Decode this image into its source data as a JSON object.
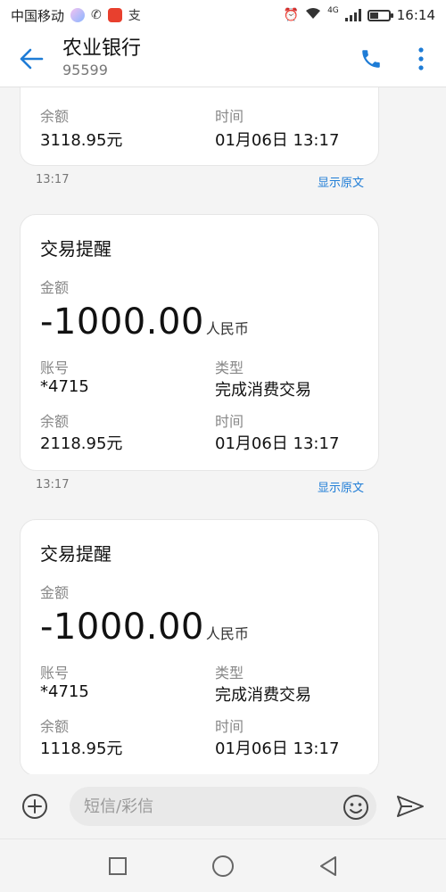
{
  "status_bar": {
    "carrier": "中国移动",
    "net_label": "4G",
    "time": "16:14",
    "battery_level": 0.45
  },
  "header": {
    "title": "农业银行",
    "subtitle": "95599"
  },
  "messages": [
    {
      "partial": true,
      "balance_label": "余额",
      "balance": "3118.95元",
      "time_label": "时间",
      "time": "01月06日 13:17",
      "timestamp": "13:17",
      "show_original": "显示原文"
    },
    {
      "title": "交易提醒",
      "amount_label": "金额",
      "amount": "-1000.00",
      "currency": "人民币",
      "account_label": "账号",
      "account": "*4715",
      "type_label": "类型",
      "type": "完成消费交易",
      "balance_label": "余额",
      "balance": "2118.95元",
      "time_label": "时间",
      "time": "01月06日 13:17",
      "timestamp": "13:17",
      "show_original": "显示原文"
    },
    {
      "title": "交易提醒",
      "amount_label": "金额",
      "amount": "-1000.00",
      "currency": "人民币",
      "account_label": "账号",
      "account": "*4715",
      "type_label": "类型",
      "type": "完成消费交易",
      "balance_label": "余额",
      "balance": "1118.95元",
      "time_label": "时间",
      "time": "01月06日 13:17"
    }
  ],
  "composer": {
    "placeholder": "短信/彩信"
  },
  "colors": {
    "accent": "#1e7cd6",
    "background": "#f4f4f4"
  }
}
